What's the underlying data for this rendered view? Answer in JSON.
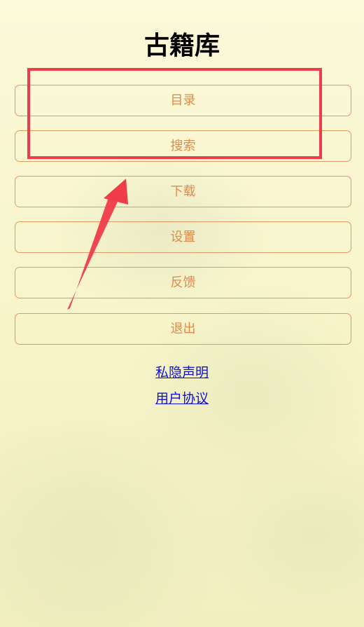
{
  "app": {
    "title": "古籍库"
  },
  "menu": {
    "items": [
      {
        "label": "目录"
      },
      {
        "label": "搜索"
      },
      {
        "label": "下载"
      },
      {
        "label": "设置"
      },
      {
        "label": "反馈"
      },
      {
        "label": "退出"
      }
    ]
  },
  "links": {
    "privacy": "私隐声明",
    "agreement": "用户协议"
  },
  "colors": {
    "background": "#f8f6cf",
    "button_border": "#e39a62",
    "button_text": "#e08a4b",
    "link": "#1010d8",
    "annotation": "#ef3b4a"
  }
}
